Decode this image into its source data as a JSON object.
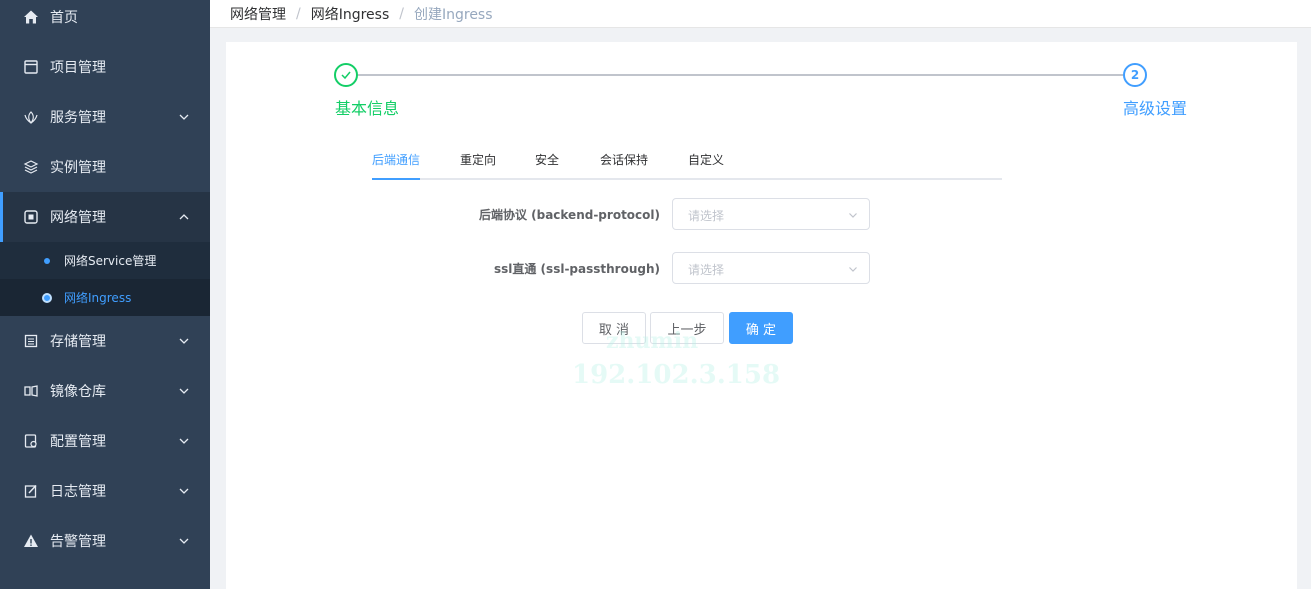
{
  "sidebar": {
    "items": [
      {
        "label": "首页",
        "icon": "home-icon",
        "expandable": false
      },
      {
        "label": "项目管理",
        "icon": "project-icon",
        "expandable": false
      },
      {
        "label": "服务管理",
        "icon": "service-icon",
        "expandable": true
      },
      {
        "label": "实例管理",
        "icon": "layers-icon",
        "expandable": false
      },
      {
        "label": "网络管理",
        "icon": "network-icon",
        "expandable": true,
        "expanded": true
      },
      {
        "label": "存储管理",
        "icon": "storage-icon",
        "expandable": true
      },
      {
        "label": "镜像仓库",
        "icon": "registry-icon",
        "expandable": true
      },
      {
        "label": "配置管理",
        "icon": "config-icon",
        "expandable": true
      },
      {
        "label": "日志管理",
        "icon": "log-icon",
        "expandable": true
      },
      {
        "label": "告警管理",
        "icon": "alert-icon",
        "expandable": true
      }
    ],
    "submenu": [
      {
        "label": "网络Service管理"
      },
      {
        "label": "网络Ingress",
        "selected": true
      }
    ]
  },
  "breadcrumb": {
    "items": [
      "网络管理",
      "网络Ingress"
    ],
    "current": "创建Ingress",
    "separator": "/"
  },
  "steps": [
    {
      "title": "基本信息",
      "status": "finished"
    },
    {
      "number": "2",
      "title": "高级设置",
      "status": "process"
    }
  ],
  "tabs": [
    "后端通信",
    "重定向",
    "安全",
    "会话保持",
    "自定义"
  ],
  "form": {
    "fields": [
      {
        "label": "后端协议 (backend-protocol)",
        "placeholder": "请选择"
      },
      {
        "label": "ssl直通 (ssl-passthrough)",
        "placeholder": "请选择"
      }
    ]
  },
  "buttons": {
    "cancel": "取 消",
    "prev": "上一步",
    "confirm": "确 定"
  },
  "watermark": {
    "line1": "zhumin",
    "line2": "192.102.3.158"
  },
  "colors": {
    "sidebar_bg": "#304156",
    "accent": "#409eff",
    "success": "#13ce66"
  }
}
